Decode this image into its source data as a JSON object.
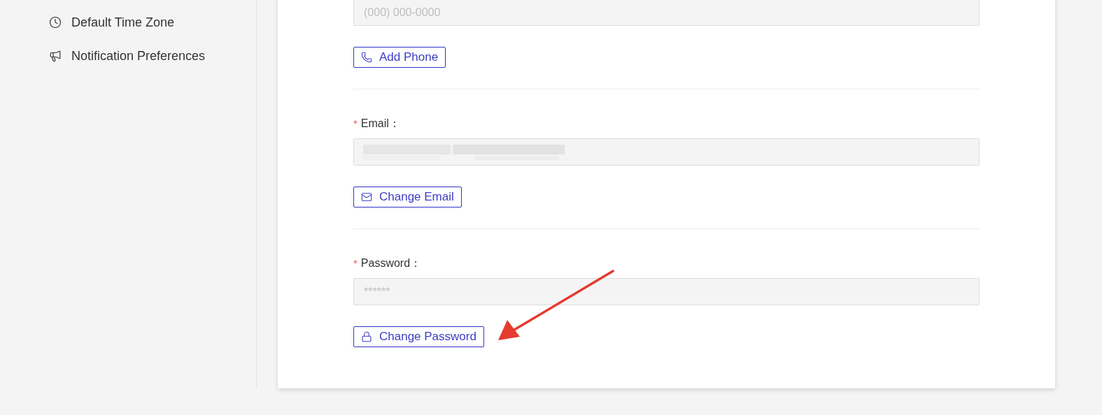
{
  "sidebar": {
    "items": [
      {
        "label": "Default Time Zone",
        "kind": "clock"
      },
      {
        "label": "Notification Preferences",
        "kind": "megaphone"
      }
    ]
  },
  "phone": {
    "placeholder": "(000) 000-0000",
    "button": "Add Phone"
  },
  "email": {
    "label": "Email",
    "required": true,
    "button": "Change Email"
  },
  "password": {
    "label": "Password",
    "required": true,
    "value": "******",
    "button": "Change Password"
  },
  "colon": "：",
  "required_mark": "*"
}
